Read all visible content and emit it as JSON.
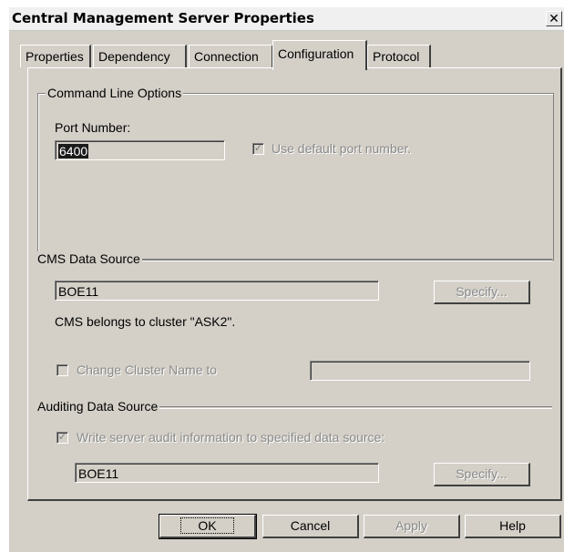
{
  "window": {
    "title": "Central Management Server Properties",
    "close_glyph": "✕"
  },
  "tabs": [
    {
      "label": "Properties",
      "active": false
    },
    {
      "label": "Dependency",
      "active": false
    },
    {
      "label": "Connection",
      "active": false
    },
    {
      "label": "Configuration",
      "active": true
    },
    {
      "label": "Protocol",
      "active": false
    }
  ],
  "command_line": {
    "group_label": "Command Line Options",
    "port_label": "Port Number:",
    "port_value": "6400",
    "use_default_label": "Use default port number.",
    "use_default_checked": true
  },
  "cms_data_source": {
    "group_label": "CMS Data Source",
    "value": "BOE11",
    "specify_label": "Specify...",
    "cluster_text": "CMS belongs to cluster \"ASK2\".",
    "change_cluster_label": "Change Cluster Name to",
    "change_cluster_checked": false,
    "change_cluster_value": ""
  },
  "auditing": {
    "group_label": "Auditing Data Source",
    "write_audit_label": "Write server audit information to specified data source:",
    "write_audit_checked": true,
    "value": "BOE11",
    "specify_label": "Specify..."
  },
  "buttons": {
    "ok": "OK",
    "cancel": "Cancel",
    "apply": "Apply",
    "help": "Help"
  },
  "checkmark_glyph": "✓"
}
